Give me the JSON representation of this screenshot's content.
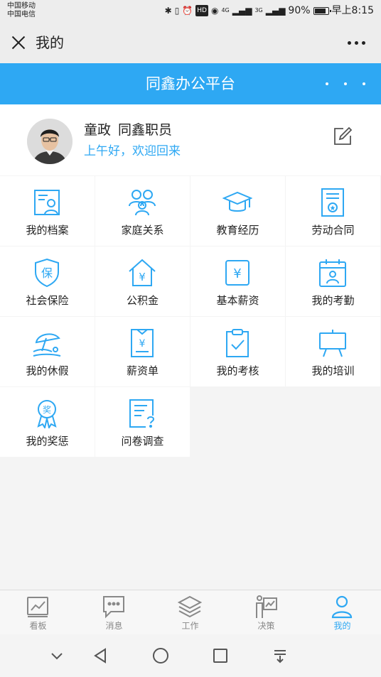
{
  "status_bar": {
    "carrier_1": "中国移动",
    "carrier_2": "中国电信",
    "network_1": "4G",
    "network_2": "3G",
    "battery": "90%",
    "time": "早上8:15"
  },
  "title_bar": {
    "title": "我的",
    "close_icon": "close-icon",
    "more_icon": "more-icon"
  },
  "app_header": {
    "title": "同鑫办公平台",
    "accent": "#2ea8f3"
  },
  "profile": {
    "name": "童政",
    "role": "同鑫职员",
    "greeting": "上午好，欢迎回来",
    "edit_icon": "edit-icon"
  },
  "grid": [
    {
      "label": "我的档案",
      "icon": "profile-card-icon"
    },
    {
      "label": "家庭关系",
      "icon": "family-icon"
    },
    {
      "label": "教育经历",
      "icon": "graduation-cap-icon"
    },
    {
      "label": "劳动合同",
      "icon": "contract-icon"
    },
    {
      "label": "社会保险",
      "icon": "shield-icon"
    },
    {
      "label": "公积金",
      "icon": "house-fund-icon"
    },
    {
      "label": "基本薪资",
      "icon": "salary-icon"
    },
    {
      "label": "我的考勤",
      "icon": "attendance-icon"
    },
    {
      "label": "我的休假",
      "icon": "beach-umbrella-icon"
    },
    {
      "label": "薪资单",
      "icon": "payslip-icon"
    },
    {
      "label": "我的考核",
      "icon": "clipboard-check-icon"
    },
    {
      "label": "我的培训",
      "icon": "easel-board-icon"
    },
    {
      "label": "我的奖惩",
      "icon": "award-medal-icon"
    },
    {
      "label": "问卷调查",
      "icon": "survey-icon"
    }
  ],
  "grid_badges": {
    "award": "奖",
    "insurance": "保",
    "yen": "¥"
  },
  "tabs": [
    {
      "label": "看板",
      "icon": "dashboard-icon",
      "active": false
    },
    {
      "label": "消息",
      "icon": "message-icon",
      "active": false
    },
    {
      "label": "工作",
      "icon": "layers-icon",
      "active": false
    },
    {
      "label": "决策",
      "icon": "presenter-icon",
      "active": false
    },
    {
      "label": "我的",
      "icon": "person-icon",
      "active": true
    }
  ]
}
